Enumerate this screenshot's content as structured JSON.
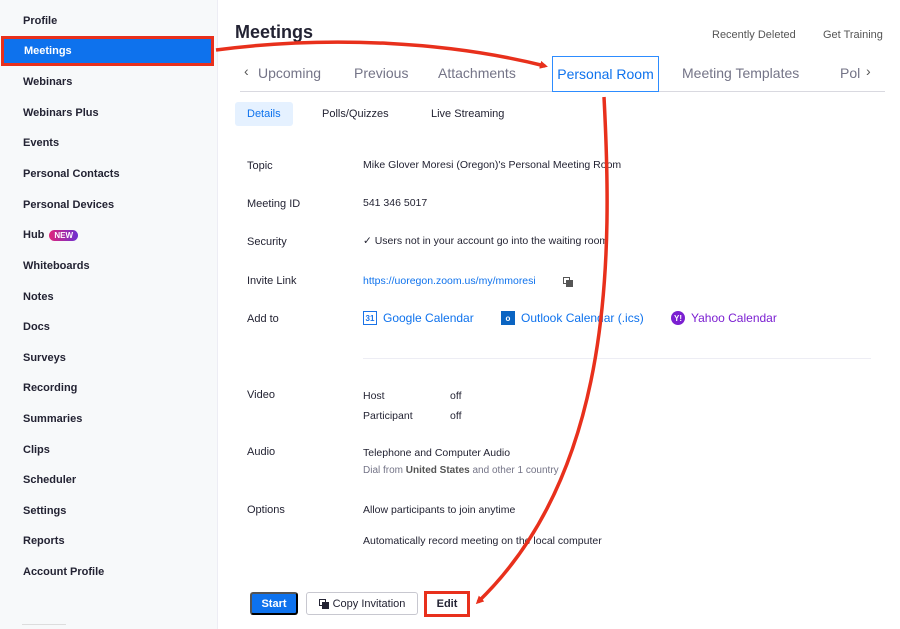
{
  "sidebar": {
    "items": [
      {
        "label": "Profile"
      },
      {
        "label": "Meetings"
      },
      {
        "label": "Webinars"
      },
      {
        "label": "Webinars Plus"
      },
      {
        "label": "Events"
      },
      {
        "label": "Personal Contacts"
      },
      {
        "label": "Personal Devices"
      },
      {
        "label": "Hub",
        "badge": "NEW"
      },
      {
        "label": "Whiteboards"
      },
      {
        "label": "Notes"
      },
      {
        "label": "Docs"
      },
      {
        "label": "Surveys"
      },
      {
        "label": "Recording"
      },
      {
        "label": "Summaries"
      },
      {
        "label": "Clips"
      },
      {
        "label": "Scheduler"
      },
      {
        "label": "Settings"
      },
      {
        "label": "Reports"
      },
      {
        "label": "Account Profile"
      }
    ],
    "active": "Meetings"
  },
  "header": {
    "title": "Meetings",
    "recently_deleted": "Recently Deleted",
    "get_training": "Get Training"
  },
  "tabs": {
    "items": [
      "Upcoming",
      "Previous",
      "Attachments",
      "Personal Room",
      "Meeting Templates",
      "Pol"
    ],
    "active": "Personal Room"
  },
  "subtabs": {
    "items": [
      "Details",
      "Polls/Quizzes",
      "Live Streaming"
    ],
    "active": "Details"
  },
  "details": {
    "topic_label": "Topic",
    "topic_value": "Mike Glover Moresi (Oregon)'s Personal Meeting Room",
    "meeting_id_label": "Meeting ID",
    "meeting_id_value": "541 346 5017",
    "security_label": "Security",
    "security_value": "✓ Users not in your account go into the waiting room",
    "invite_label": "Invite Link",
    "invite_value": "https://uoregon.zoom.us/my/mmoresi",
    "add_to_label": "Add to",
    "calendars": {
      "google": "Google Calendar",
      "google_icon": "31",
      "outlook": "Outlook Calendar (.ics)",
      "outlook_icon": "o",
      "yahoo": "Yahoo Calendar",
      "yahoo_icon": "Y!"
    },
    "video_label": "Video",
    "host_label": "Host",
    "host_value": "off",
    "participant_label": "Participant",
    "participant_value": "off",
    "audio_label": "Audio",
    "audio_value": "Telephone and Computer Audio",
    "dial_prefix": "Dial from",
    "dial_country": "United States",
    "dial_suffix": "and other 1 country",
    "options_label": "Options",
    "option_1": "Allow participants to join anytime",
    "option_2": "Automatically record meeting on the local computer"
  },
  "actions": {
    "start": "Start",
    "copy_invitation": "Copy Invitation",
    "edit": "Edit"
  },
  "colors": {
    "accent": "#0e72ed",
    "annotation": "#e8301c"
  }
}
